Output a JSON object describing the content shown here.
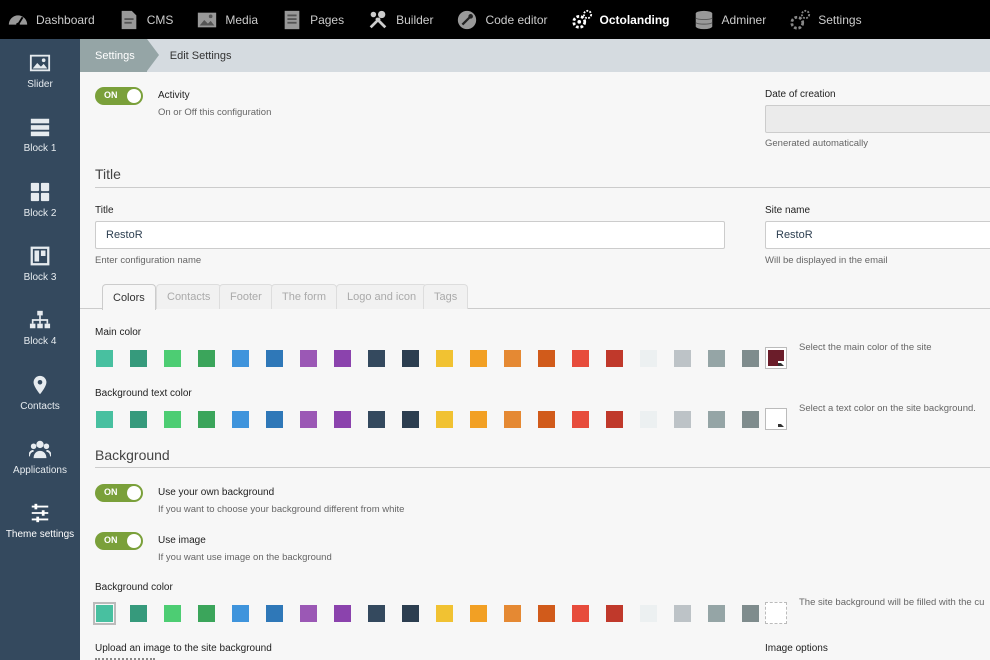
{
  "topnav": [
    {
      "label": "Dashboard",
      "icon": "dashboard-icon"
    },
    {
      "label": "CMS",
      "icon": "cms-icon"
    },
    {
      "label": "Media",
      "icon": "media-icon"
    },
    {
      "label": "Pages",
      "icon": "pages-icon"
    },
    {
      "label": "Builder",
      "icon": "builder-icon"
    },
    {
      "label": "Code editor",
      "icon": "code-editor-icon"
    },
    {
      "label": "Octolanding",
      "icon": "octolanding-icon"
    },
    {
      "label": "Adminer",
      "icon": "adminer-icon"
    },
    {
      "label": "Settings",
      "icon": "settings-icon"
    }
  ],
  "sidebar": [
    {
      "label": "Slider",
      "icon": "image-icon"
    },
    {
      "label": "Block 1",
      "icon": "rows-icon"
    },
    {
      "label": "Block 2",
      "icon": "grid-icon"
    },
    {
      "label": "Block 3",
      "icon": "layout-icon"
    },
    {
      "label": "Block 4",
      "icon": "sitemap-icon"
    },
    {
      "label": "Contacts",
      "icon": "map-marker-icon"
    },
    {
      "label": "Applications",
      "icon": "users-icon"
    },
    {
      "label": "Theme settings",
      "icon": "sliders-icon"
    }
  ],
  "breadcrumb": {
    "first": "Settings",
    "second": "Edit Settings"
  },
  "activity": {
    "toggle": "ON",
    "label": "Activity",
    "hint": "On or Off this configuration"
  },
  "date_of_creation": {
    "label": "Date of creation",
    "value": "",
    "hint": "Generated automatically"
  },
  "title_section": "Title",
  "title_field": {
    "label": "Title",
    "value": "RestoR",
    "hint": "Enter configuration name"
  },
  "site_name": {
    "label": "Site name",
    "value": "RestoR",
    "hint": "Will be displayed in the email"
  },
  "tabs": [
    "Colors",
    "Contacts",
    "Footer",
    "The form",
    "Logo and icon",
    "Tags"
  ],
  "main_color": {
    "label": "Main color",
    "hint": "Select the main color of the site",
    "selected": "#6b1d2a"
  },
  "bg_text_color": {
    "label": "Background text color",
    "hint": "Select a text color on the site background.",
    "selected": "#ffffff"
  },
  "background_section": "Background",
  "own_background": {
    "toggle": "ON",
    "label": "Use your own background",
    "hint": "If you want to choose your background different from white"
  },
  "use_image": {
    "toggle": "ON",
    "label": "Use image",
    "hint": "If you want use image on the background"
  },
  "bg_color": {
    "label": "Background color",
    "hint": "The site background will be filled with the cu",
    "selected": "#ffffff"
  },
  "upload_label": "Upload an image to the site background",
  "image_options_label": "Image options",
  "palette": [
    "#48c0a0",
    "#369a7c",
    "#4dcd73",
    "#3ba55b",
    "#3f94dc",
    "#2f78b8",
    "#9b58b5",
    "#8b43ad",
    "#34495e",
    "#2c3e50",
    "#f1c232",
    "#f2a024",
    "#e58933",
    "#d15b1b",
    "#e74c3c",
    "#c0392b",
    "#ecf0f1",
    "#bdc3c7",
    "#95a5a6",
    "#7f8c8d"
  ]
}
